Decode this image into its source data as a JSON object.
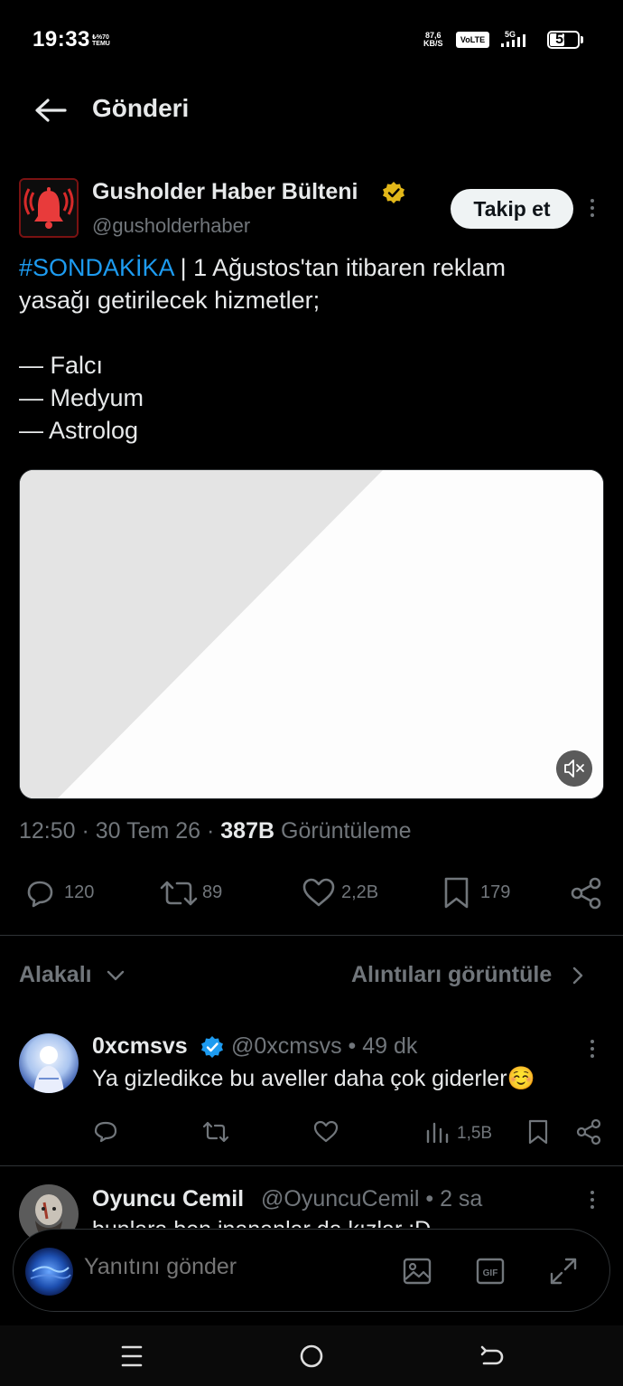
{
  "status_bar": {
    "time": "19:33",
    "mini_line1": "₺%70",
    "mini_line2": "TEMU",
    "speed_value": "87,6",
    "speed_unit": "KB/S",
    "volte": "VoLTE",
    "network": "5G",
    "battery": "50"
  },
  "header": {
    "title": "Gönderi"
  },
  "post": {
    "author_name": "Gusholder Haber Bülteni",
    "author_handle": "@gusholderhaber",
    "follow_label": "Takip et",
    "hashtag": "#SONDAKİKA",
    "text_line1_rest": " | 1 Ağustos'tan itibaren reklam",
    "text_line2": "yasağı getirilecek hizmetler;",
    "list": [
      "— Falcı",
      "— Medyum",
      "— Astrolog"
    ],
    "meta_time": "12:50 · 30 Tem 26 · ",
    "meta_views": "387B",
    "meta_views_label": " Görüntüleme",
    "stats": {
      "replies": "120",
      "reposts": "89",
      "likes": "2,2B",
      "bookmarks": "179"
    }
  },
  "sort": {
    "label": "Alakalı",
    "quotes_link": "Alıntıları görüntüle"
  },
  "replies": [
    {
      "name": "0xcmsvs",
      "handle": "@0xcmsvs • 49 dk",
      "text": "Ya gizledikce bu aveller daha çok giderler☺️",
      "views": "1,5B"
    },
    {
      "name": "Oyuncu Cemil",
      "handle": "@OyuncuCemil • 2 sa",
      "text": "bunlara ben inananlar da kızlar :D"
    }
  ],
  "composer": {
    "placeholder": "Yanıtını gönder"
  },
  "colors": {
    "accent": "#1d9bf0",
    "verified_gold": "#e2b719",
    "muted": "#71767b",
    "border": "#2f3336"
  }
}
